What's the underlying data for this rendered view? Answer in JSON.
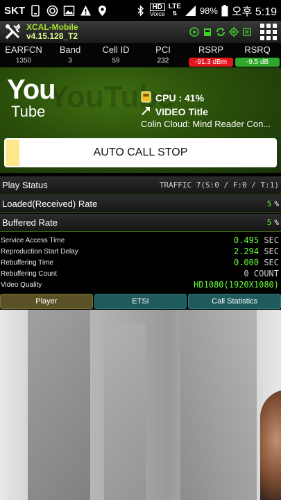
{
  "status_bar": {
    "carrier": "SKT",
    "hd_label": "HD",
    "voice_label": "Voice",
    "lte_label": "LTE",
    "battery": "98%",
    "time": "오후 5:19"
  },
  "app_header": {
    "app_name": "XCAL-Mobile",
    "version": "v4.15.128_T2"
  },
  "cell_info": {
    "columns": [
      {
        "label": "EARFCN",
        "value": "1350"
      },
      {
        "label": "Band",
        "value": "3"
      },
      {
        "label": "Cell ID",
        "value": "59"
      },
      {
        "label": "PCI",
        "value": "232"
      },
      {
        "label": "RSRP",
        "value": "-91.3 dBm",
        "color": "#e0181e"
      },
      {
        "label": "RSRQ",
        "value": "-9.5 dB",
        "color": "#2ea82a"
      }
    ]
  },
  "service_panel": {
    "logo_top": "You",
    "logo_bottom": "Tube",
    "logo_watermark": "YouTube",
    "cpu": "CPU : 41%",
    "video_title_label": "VIDEO Title",
    "video_name": "Colin Cloud: Mind Reader Con...",
    "auto_call_button": "AUTO CALL STOP"
  },
  "stats": {
    "play_status_label": "Play Status",
    "play_status_value": "TRAFFIC 7(S:0 / F:0 / T:1)",
    "loaded_rate_label": "Loaded(Received) Rate",
    "loaded_rate_value": "5",
    "buffered_rate_label": "Buffered Rate",
    "buffered_rate_value": "5",
    "percent_unit": "%"
  },
  "timings": [
    {
      "label": "Service Access Time",
      "value": "0.495",
      "unit": "SEC"
    },
    {
      "label": "Reproduction Start Delay",
      "value": "2.294",
      "unit": "SEC"
    },
    {
      "label": "Rebuffering Time",
      "value": "0.000",
      "unit": "SEC"
    },
    {
      "label": "Rebuffering Count",
      "value": "0",
      "unit": "COUNT"
    },
    {
      "label": "Video Quality",
      "value": "HD1080(1920X1080)",
      "unit": ""
    }
  ],
  "tabs": [
    {
      "label": "Player",
      "active": true
    },
    {
      "label": "ETSI",
      "active": false
    },
    {
      "label": "Call Statistics",
      "active": false
    }
  ],
  "colors": {
    "accent_green": "#6bff3a",
    "panel_green": "#2a4f0a",
    "tab_active": "#5a5226",
    "tab_inactive": "#1f5a5c"
  },
  "icons": [
    "sim-icon",
    "sync-icon",
    "image-icon",
    "warning-icon",
    "location-icon",
    "bluetooth-icon",
    "signal-icon",
    "battery-icon",
    "tools-icon",
    "play-icon",
    "sdcard-icon",
    "refresh-icon",
    "gps-icon",
    "chip-icon",
    "grid-menu-icon",
    "cpu-icon",
    "arrow-icon"
  ]
}
